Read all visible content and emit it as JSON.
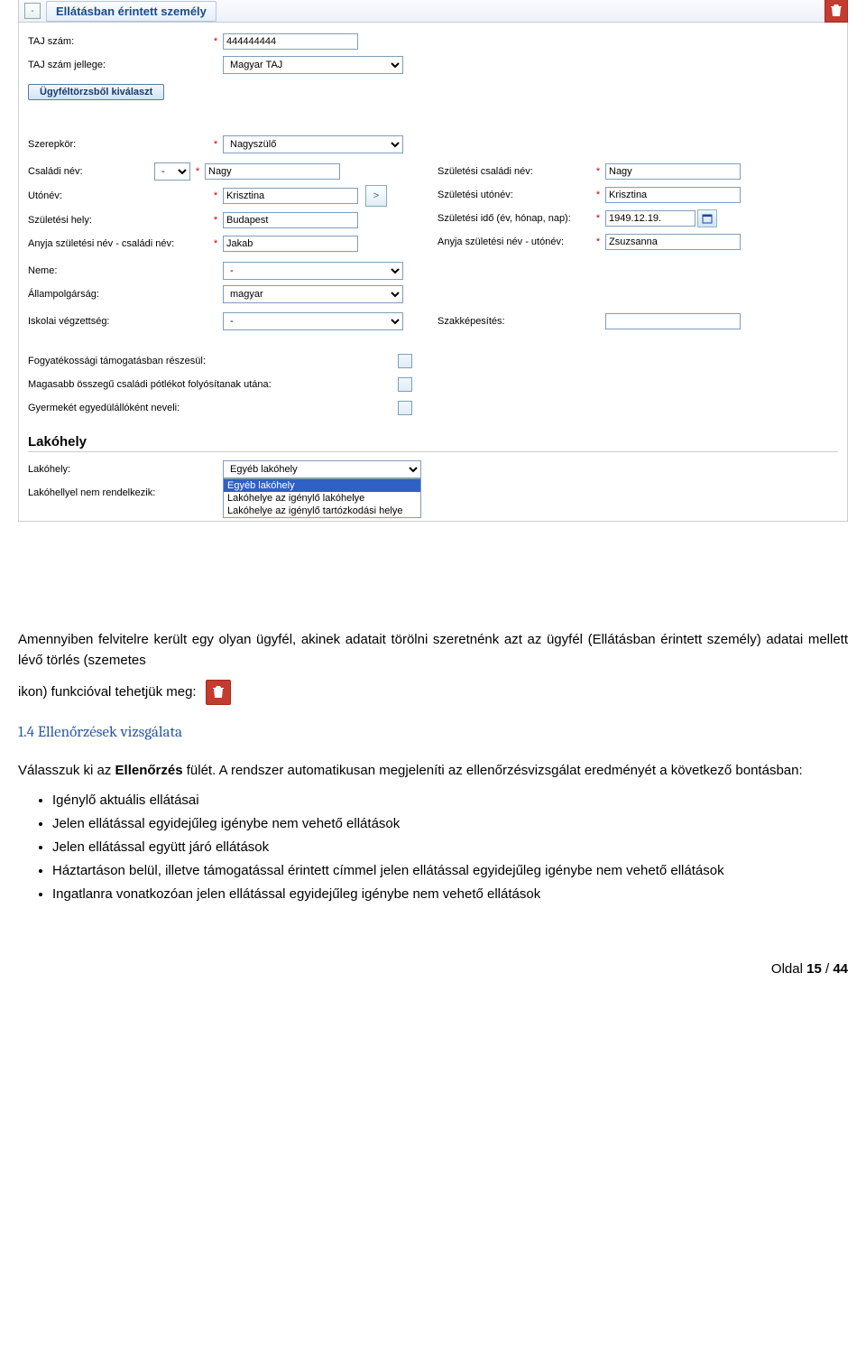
{
  "panel": {
    "title": "Ellátásban érintett személy"
  },
  "labels": {
    "taj": "TAJ szám:",
    "tajType": "TAJ szám jellege:",
    "pickClient": "Ügyféltörzsből kiválaszt",
    "role": "Szerepkör:",
    "family": "Családi név:",
    "given": "Utónév:",
    "birthFamily": "Születési családi név:",
    "birthGiven": "Születési utónév:",
    "birthPlace": "Születési hely:",
    "birthDate": "Születési idő (év, hónap, nap):",
    "motherFamily": "Anyja születési név - családi név:",
    "motherGiven": "Anyja születési név - utónév:",
    "gender": "Neme:",
    "citizenship": "Állampolgárság:",
    "education": "Iskolai végzettség:",
    "qualification": "Szakképesítés:",
    "disability": "Fogyatékossági támogatásban részesül:",
    "familySupp": "Magasabb összegű családi pótlékot folyósítanak utána:",
    "singleParent": "Gyermekét egyedülállóként neveli:",
    "residenceTitle": "Lakóhely",
    "residence": "Lakóhely:",
    "noResidence": "Lakóhellyel nem rendelkezik:"
  },
  "values": {
    "taj": "444444444",
    "tajType": "Magyar TAJ",
    "role": "Nagyszülő",
    "prefix": "-",
    "family": "Nagy",
    "given": "Krisztina",
    "birthFamily": "Nagy",
    "birthGiven": "Krisztina",
    "birthPlace": "Budapest",
    "birthDate": "1949.12.19.",
    "motherFamily": "Jakab",
    "motherGiven": "Zsuzsanna",
    "gender": "-",
    "citizenship": "magyar",
    "education": "-",
    "residence": "Egyéb lakóhely",
    "resOptions": [
      "Egyéb lakóhely",
      "Lakóhelye az igénylő lakóhelye",
      "Lakóhelye az igénylő tartózkodási helye"
    ]
  },
  "doc": {
    "p1a": "Amennyiben felvitelre került egy olyan ügyfél, akinek adatait törölni szeretnénk azt az ügyfél (Ellátásban érintett személy) adatai mellett lévő törlés (szemetes",
    "p1b": "ikon) funkcióval tehetjük meg:",
    "h": "1.4  Ellenőrzések vizsgálata",
    "p2a": "Válasszuk ki az ",
    "p2b": "Ellenőrzés",
    "p2c": " fülét. A rendszer automatikusan megjeleníti az ellenőrzésvizsgálat eredményét a következő bontásban:",
    "li1": "Igénylő aktuális ellátásai",
    "li2": "Jelen ellátással egyidejűleg igénybe nem vehető ellátások",
    "li3": "Jelen ellátással együtt járó ellátások",
    "li4": "Háztartáson belül, illetve támogatással érintett címmel jelen ellátással egyidejűleg igénybe nem vehető ellátások",
    "li5": "Ingatlanra vonatkozóan jelen ellátással egyidejűleg igénybe nem vehető ellátások",
    "footer_a": "Oldal ",
    "footer_b": "15",
    "footer_c": " / ",
    "footer_d": "44"
  }
}
